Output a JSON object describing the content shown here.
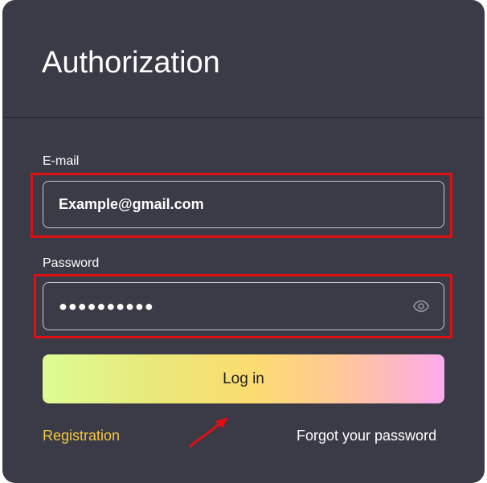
{
  "form": {
    "title": "Authorization",
    "email_label": "E-mail",
    "email_value": "Example@gmail.com",
    "password_label": "Password",
    "password_value": "●●●●●●●●●●",
    "login_label": "Log in",
    "registration_label": "Registration",
    "forgot_label": "Forgot your password"
  },
  "icons": {
    "password_toggle": "eye-icon",
    "annotation": "arrow-annotation"
  },
  "colors": {
    "card_background": "#3a3b46",
    "highlight": "#e00f14",
    "registration_link": "#f7c940",
    "button_gradient": [
      "#dbfd93",
      "#fcdc70",
      "#fdaaeb"
    ]
  }
}
